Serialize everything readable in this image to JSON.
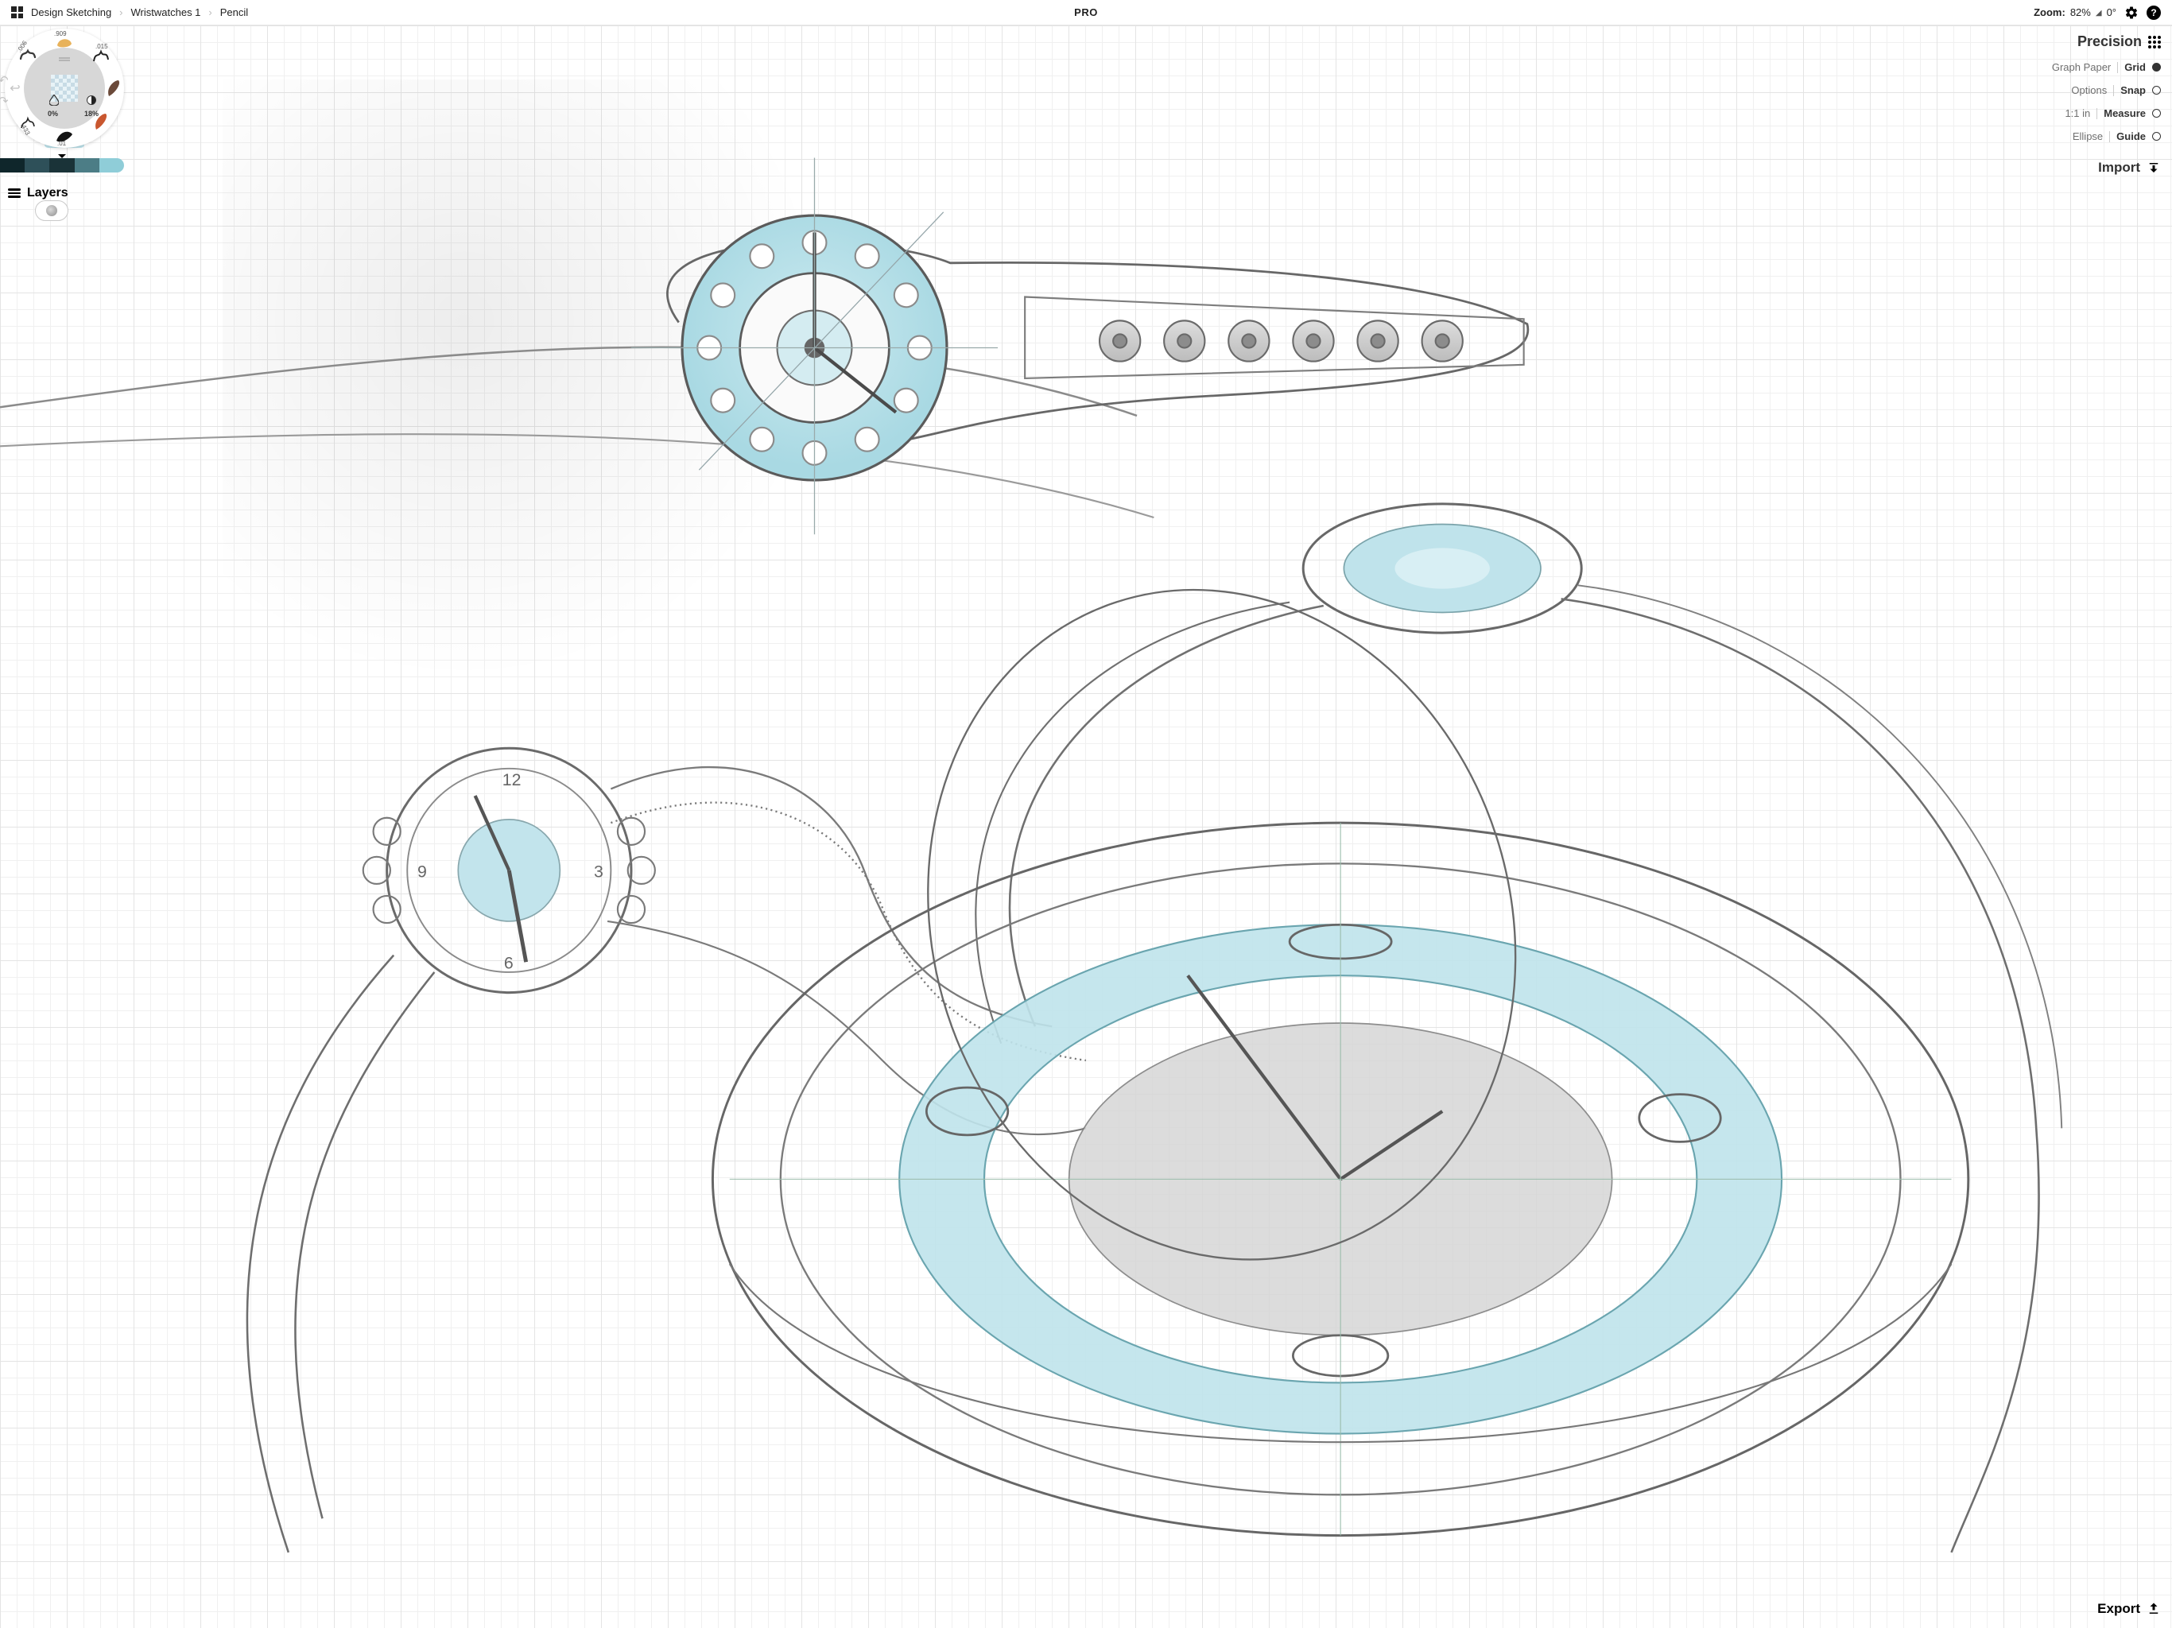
{
  "breadcrumbs": {
    "a": "Design Sketching",
    "b": "Wristwatches 1",
    "c": "Pencil"
  },
  "topbar": {
    "pro": "PRO"
  },
  "zoom": {
    "label": "Zoom:",
    "pct": "82%",
    "angle": "0°"
  },
  "precision": {
    "title": "Precision",
    "row1a": "Graph Paper",
    "row1b": "Grid",
    "row2a": "Options",
    "row2b": "Snap",
    "row3a": "1:1 in",
    "row3b": "Measure",
    "row4a": "Ellipse",
    "row4b": "Guide",
    "import": "Import"
  },
  "export_label": "Export",
  "layers": {
    "title": "Layers"
  },
  "wheel": {
    "opacity_left": "0%",
    "opacity_right": "18%",
    "labels": {
      "l0": ".909",
      "l1": ".015",
      "l5": ".433",
      "l4": ".01",
      "l7": ".006"
    }
  },
  "sketch": {
    "numerals": {
      "n12": "12",
      "n3": "3",
      "n6": "6",
      "n9": "9"
    }
  }
}
